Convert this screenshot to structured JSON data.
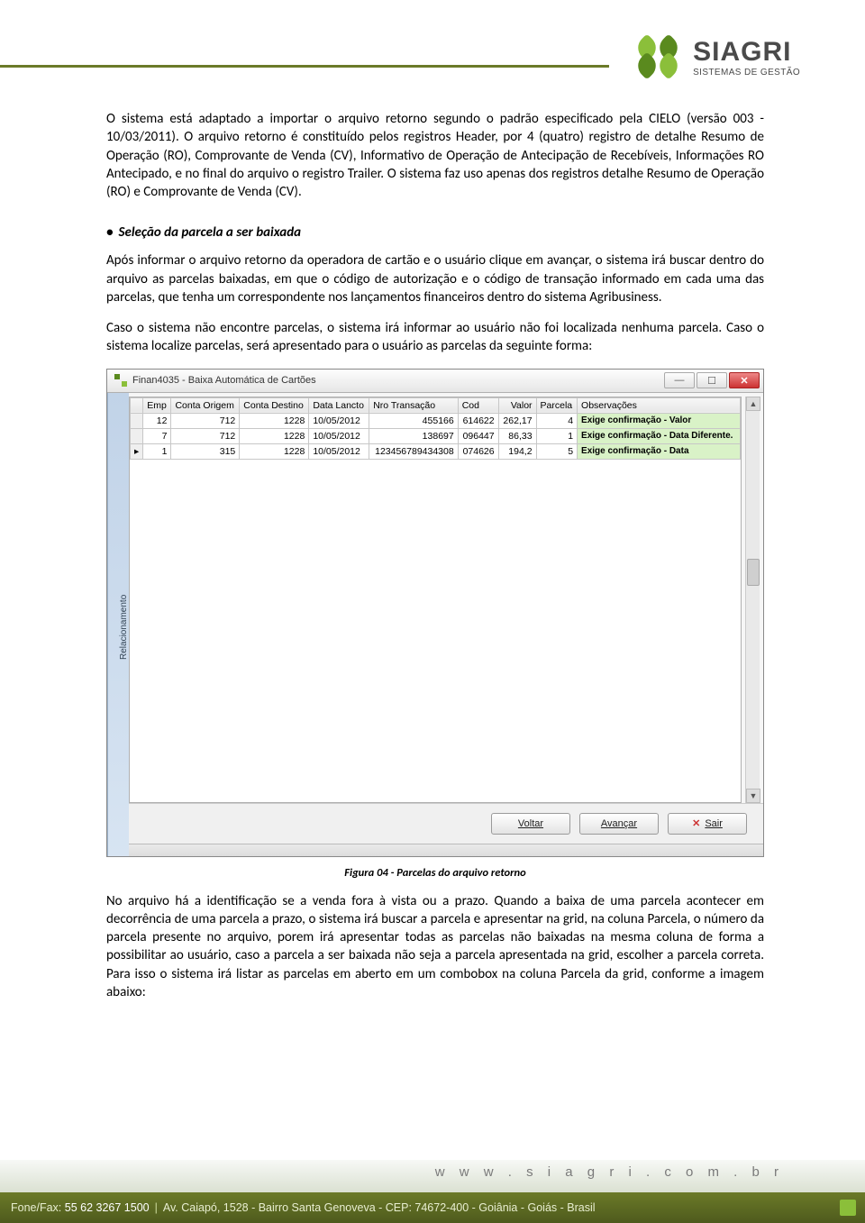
{
  "logo": {
    "brand": "SIAGRI",
    "tagline": "SISTEMAS DE GESTÃO"
  },
  "body": {
    "p1": "O sistema está adaptado a importar o arquivo retorno segundo o padrão especificado pela CIELO (versão 003 - 10/03/2011). O arquivo retorno é constituído pelos registros Header, por 4 (quatro) registro de detalhe Resumo de Operação (RO), Comprovante de Venda (CV), Informativo de Operação de Antecipação de Recebíveis, Informações RO Antecipado, e no final do arquivo o registro Trailer. O sistema faz uso apenas dos registros detalhe Resumo de Operação (RO) e Comprovante de Venda (CV).",
    "section_title": "Seleção da parcela a ser baixada",
    "p2": "Após informar o arquivo retorno da operadora de cartão e o usuário clique em avançar, o sistema irá buscar dentro do arquivo as parcelas baixadas, em que o código de autorização e o código de transação informado em cada uma das parcelas, que tenha um correspondente nos lançamentos financeiros dentro do sistema Agribusiness.",
    "p3": "Caso o sistema não encontre parcelas, o sistema irá informar ao usuário não foi localizada nenhuma parcela. Caso o sistema localize parcelas, será apresentado para o usuário as parcelas da seguinte forma:",
    "figure_caption": "Figura 04 - Parcelas do arquivo retorno",
    "p4": "No arquivo há a identificação se a venda fora à vista ou a prazo. Quando a baixa de uma parcela acontecer em decorrência de uma parcela a prazo, o sistema irá buscar a parcela e apresentar na grid, na coluna Parcela, o número da parcela presente no arquivo, porem irá apresentar todas as parcelas não baixadas na mesma coluna de forma a possibilitar ao usuário, caso a parcela a ser baixada não seja a parcela apresentada na grid, escolher a parcela correta. Para isso o sistema irá listar as parcelas em aberto em um combobox na coluna Parcela da grid, conforme a imagem abaixo:"
  },
  "window": {
    "title": "Finan4035 - Baixa Automática de Cartões",
    "side_tab": "Relacionamento",
    "columns": [
      "Emp",
      "Conta Origem",
      "Conta Destino",
      "Data Lancto",
      "Nro Transação",
      "Cod",
      "Valor",
      "Parcela",
      "Observações"
    ],
    "rows": [
      {
        "mark": "",
        "emp": "12",
        "corig": "712",
        "cdest": "1228",
        "data": "10/05/2012",
        "ntr": "455166",
        "cod": "614622",
        "valor": "262,17",
        "parc": "4",
        "obs": "Exige confirmação - Valor"
      },
      {
        "mark": "",
        "emp": "7",
        "corig": "712",
        "cdest": "1228",
        "data": "10/05/2012",
        "ntr": "138697",
        "cod": "096447",
        "valor": "86,33",
        "parc": "1",
        "obs": "Exige confirmação - Data Diferente."
      },
      {
        "mark": "▸",
        "emp": "1",
        "corig": "315",
        "cdest": "1228",
        "data": "10/05/2012",
        "ntr": "123456789434308",
        "cod": "074626",
        "valor": "194,2",
        "parc": "5",
        "obs": "Exige confirmação - Data"
      }
    ],
    "buttons": {
      "back": "Voltar",
      "next": "Avançar",
      "exit": "Sair"
    }
  },
  "footer": {
    "url": "w w w . s i a g r i . c o m . b r",
    "phone_label": "Fone/Fax:",
    "phone": "55 62 3267 1500",
    "address": "Av. Caiapó, 1528 - Bairro Santa Genoveva - CEP: 74672-400 - Goiânia - Goiás - Brasil"
  }
}
